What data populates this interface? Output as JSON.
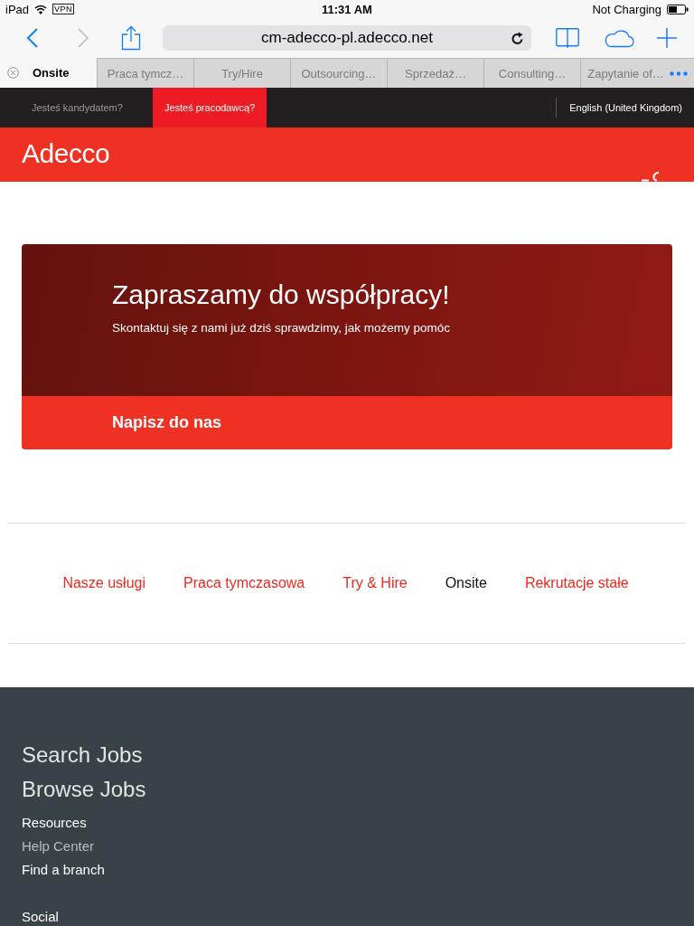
{
  "status_bar": {
    "device": "iPad",
    "vpn": "VPN",
    "time": "11:31 AM",
    "charging": "Not Charging"
  },
  "browser_toolbar": {
    "back": {
      "disabled": false
    },
    "forward": {
      "disabled": true
    },
    "url": "cm-adecco-pl.adecco.net"
  },
  "browser_tabs": [
    {
      "label": "Onsite",
      "selected": true
    },
    {
      "label": "Praca tymcz…",
      "selected": false
    },
    {
      "label": "Try/Hire",
      "selected": false
    },
    {
      "label": "Outsourcing…",
      "selected": false
    },
    {
      "label": "Sprzedaż…",
      "selected": false
    },
    {
      "label": "Consulting…",
      "selected": false
    },
    {
      "label": "Zapytanie of…",
      "selected": false
    }
  ],
  "site_nav": {
    "audience_tabs": [
      {
        "label": "Jesteś kandydatem?",
        "selected": false
      },
      {
        "label": "Jesteś pracodawcą?",
        "selected": true
      }
    ],
    "language": "English (United Kingdom)"
  },
  "header": {
    "logo": "Adecco"
  },
  "banner": {
    "title": "Zapraszamy do współpracy!",
    "subtitle": "Skontaktuj się z nami już dziś sprawdzimy, jak możemy pomóc",
    "button": "Napisz do nas"
  },
  "service_links": [
    {
      "label": "Nasze usługi",
      "selected": false
    },
    {
      "label": "Praca tymczasowa",
      "selected": false
    },
    {
      "label": "Try & Hire",
      "selected": false
    },
    {
      "label": "Onsite",
      "selected": true
    },
    {
      "label": "Rekrutacje stałe",
      "selected": false
    }
  ],
  "footer": {
    "headings": [
      "Search Jobs",
      "Browse Jobs"
    ],
    "links": [
      {
        "label": "Resources",
        "dimmed": false
      },
      {
        "label": "Help Center",
        "dimmed": true
      },
      {
        "label": "Find a branch",
        "dimmed": false
      }
    ],
    "section_title": "Social"
  }
}
